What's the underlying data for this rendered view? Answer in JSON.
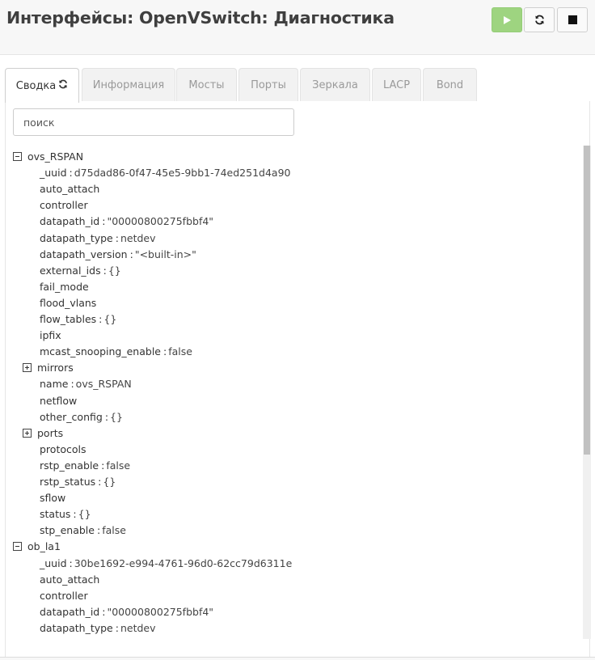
{
  "page": {
    "title": "Интерфейсы: OpenVSwitch: Диагностика"
  },
  "controls": {
    "start_icon": "play-icon",
    "restart_icon": "refresh-icon",
    "stop_icon": "stop-icon",
    "start_color": "#9ed480"
  },
  "tabs": [
    {
      "label": "Сводка",
      "active": true
    },
    {
      "label": "Информация"
    },
    {
      "label": "Мосты"
    },
    {
      "label": "Порты"
    },
    {
      "label": "Зеркала"
    },
    {
      "label": "LACP"
    },
    {
      "label": "Bond"
    }
  ],
  "search": {
    "placeholder": "поиск",
    "value": ""
  },
  "tree": [
    {
      "kind": "node",
      "label": "ovs_RSPAN",
      "expanded": true
    },
    {
      "kind": "kv",
      "key": "_uuid",
      "value": "d75dad86-0f47-45e5-9bb1-74ed251d4a90"
    },
    {
      "kind": "key",
      "key": "auto_attach"
    },
    {
      "kind": "key",
      "key": "controller"
    },
    {
      "kind": "kv",
      "key": "datapath_id",
      "value": "\"00000800275fbbf4\""
    },
    {
      "kind": "kv",
      "key": "datapath_type",
      "value": "netdev"
    },
    {
      "kind": "kv",
      "key": "datapath_version",
      "value": "\"<built-in>\""
    },
    {
      "kind": "kv",
      "key": "external_ids",
      "value": "{}"
    },
    {
      "kind": "key",
      "key": "fail_mode"
    },
    {
      "kind": "key",
      "key": "flood_vlans"
    },
    {
      "kind": "kv",
      "key": "flow_tables",
      "value": "{}"
    },
    {
      "kind": "key",
      "key": "ipfix"
    },
    {
      "kind": "kv",
      "key": "mcast_snooping_enable",
      "value": "false"
    },
    {
      "kind": "subnode",
      "label": "mirrors",
      "expanded": false
    },
    {
      "kind": "kv",
      "key": "name",
      "value": "ovs_RSPAN"
    },
    {
      "kind": "key",
      "key": "netflow"
    },
    {
      "kind": "kv",
      "key": "other_config",
      "value": "{}"
    },
    {
      "kind": "subnode",
      "label": "ports",
      "expanded": false
    },
    {
      "kind": "key",
      "key": "protocols"
    },
    {
      "kind": "kv",
      "key": "rstp_enable",
      "value": "false"
    },
    {
      "kind": "kv",
      "key": "rstp_status",
      "value": "{}"
    },
    {
      "kind": "key",
      "key": "sflow"
    },
    {
      "kind": "kv",
      "key": "status",
      "value": "{}"
    },
    {
      "kind": "kv",
      "key": "stp_enable",
      "value": "false"
    },
    {
      "kind": "node",
      "label": "ob_la1",
      "expanded": true
    },
    {
      "kind": "kv",
      "key": "_uuid",
      "value": "30be1692-e994-4761-96d0-62cc79d6311e"
    },
    {
      "kind": "key",
      "key": "auto_attach"
    },
    {
      "kind": "key",
      "key": "controller"
    },
    {
      "kind": "kv",
      "key": "datapath_id",
      "value": "\"00000800275fbbf4\""
    },
    {
      "kind": "kv",
      "key": "datapath_type",
      "value": "netdev"
    }
  ]
}
